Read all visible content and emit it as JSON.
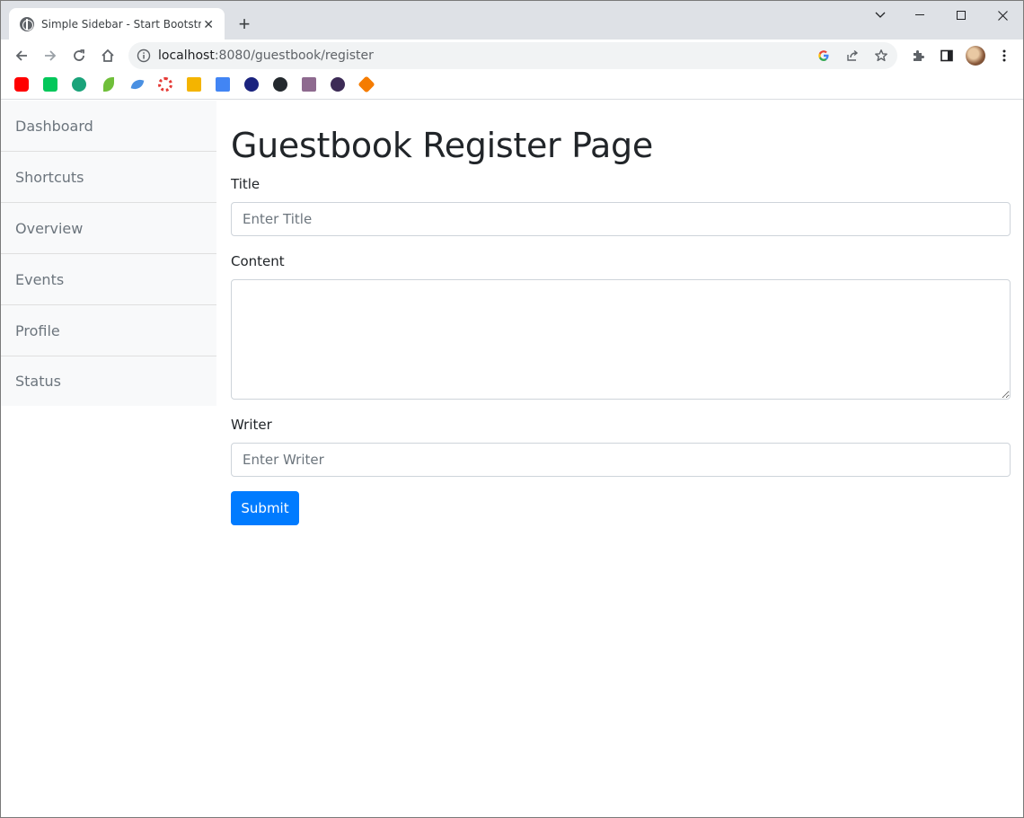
{
  "browser": {
    "tab_title": "Simple Sidebar - Start Bootstrap",
    "url_host": "localhost",
    "url_path": ":8080/guestbook/register",
    "icons": [
      "globe-icon",
      "close-icon",
      "plus-icon",
      "chevron-down-icon",
      "minimize-icon",
      "maximize-icon",
      "close-window-icon",
      "back-icon",
      "forward-icon",
      "reload-icon",
      "home-icon",
      "info-icon",
      "google-icon",
      "share-icon",
      "star-icon",
      "puzzle-icon",
      "side-panel-icon",
      "avatar",
      "kebab-menu-icon"
    ]
  },
  "bookmarks": [
    {
      "name": "youtube-bookmark-icon",
      "color": "#ff0000"
    },
    {
      "name": "naver-bookmark-icon",
      "color": "#03c75a"
    },
    {
      "name": "green-circle-bookmark-icon",
      "color": "#1aa37a"
    },
    {
      "name": "leaf-bookmark-icon",
      "color": "#6fbf3a"
    },
    {
      "name": "feather-bookmark-icon",
      "color": "#4a90e2"
    },
    {
      "name": "red-ring-bookmark-icon",
      "color": "#e53935"
    },
    {
      "name": "classroom-bookmark-icon",
      "color": "#f4b400"
    },
    {
      "name": "blue-grid-bookmark-icon",
      "color": "#4285f4"
    },
    {
      "name": "owl-bookmark-icon",
      "color": "#1a237e"
    },
    {
      "name": "github-bookmark-icon",
      "color": "#24292e"
    },
    {
      "name": "photo-bookmark-icon",
      "color": "#8e6a8f"
    },
    {
      "name": "dark-avatar-bookmark-icon",
      "color": "#3d2b56"
    },
    {
      "name": "orange-cube-bookmark-icon",
      "color": "#f57c00"
    }
  ],
  "sidebar": {
    "items": [
      {
        "label": "Dashboard"
      },
      {
        "label": "Shortcuts"
      },
      {
        "label": "Overview"
      },
      {
        "label": "Events"
      },
      {
        "label": "Profile"
      },
      {
        "label": "Status"
      }
    ]
  },
  "form": {
    "page_title": "Guestbook Register Page",
    "title_label": "Title",
    "title_placeholder": "Enter Title",
    "content_label": "Content",
    "writer_label": "Writer",
    "writer_placeholder": "Enter Writer",
    "submit_label": "Submit"
  },
  "colors": {
    "primary": "#007bff",
    "sidebar_bg": "#f8f9fa",
    "text": "#212529"
  }
}
